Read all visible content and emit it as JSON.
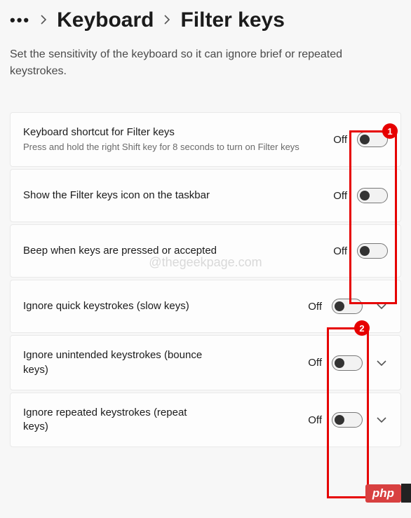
{
  "breadcrumb": {
    "more": "•••",
    "parent": "Keyboard",
    "current": "Filter keys"
  },
  "description": "Set the sensitivity of the keyboard so it can ignore brief or repeated keystrokes.",
  "watermark": "@thegeekpage.com",
  "state_off": "Off",
  "settings": [
    {
      "title": "Keyboard shortcut for Filter keys",
      "sub": "Press and hold the right Shift key for 8 seconds to turn on Filter keys",
      "state": "Off",
      "expandable": false
    },
    {
      "title": "Show the Filter keys icon on the taskbar",
      "sub": "",
      "state": "Off",
      "expandable": false
    },
    {
      "title": "Beep when keys are pressed or accepted",
      "sub": "",
      "state": "Off",
      "expandable": false
    },
    {
      "title": "Ignore quick keystrokes (slow keys)",
      "sub": "",
      "state": "Off",
      "expandable": true
    },
    {
      "title": "Ignore unintended keystrokes (bounce keys)",
      "sub": "",
      "state": "Off",
      "expandable": true
    },
    {
      "title": "Ignore repeated keystrokes (repeat keys)",
      "sub": "",
      "state": "Off",
      "expandable": true
    }
  ],
  "annotations": {
    "box1_label": "1",
    "box2_label": "2"
  },
  "badge": "php"
}
